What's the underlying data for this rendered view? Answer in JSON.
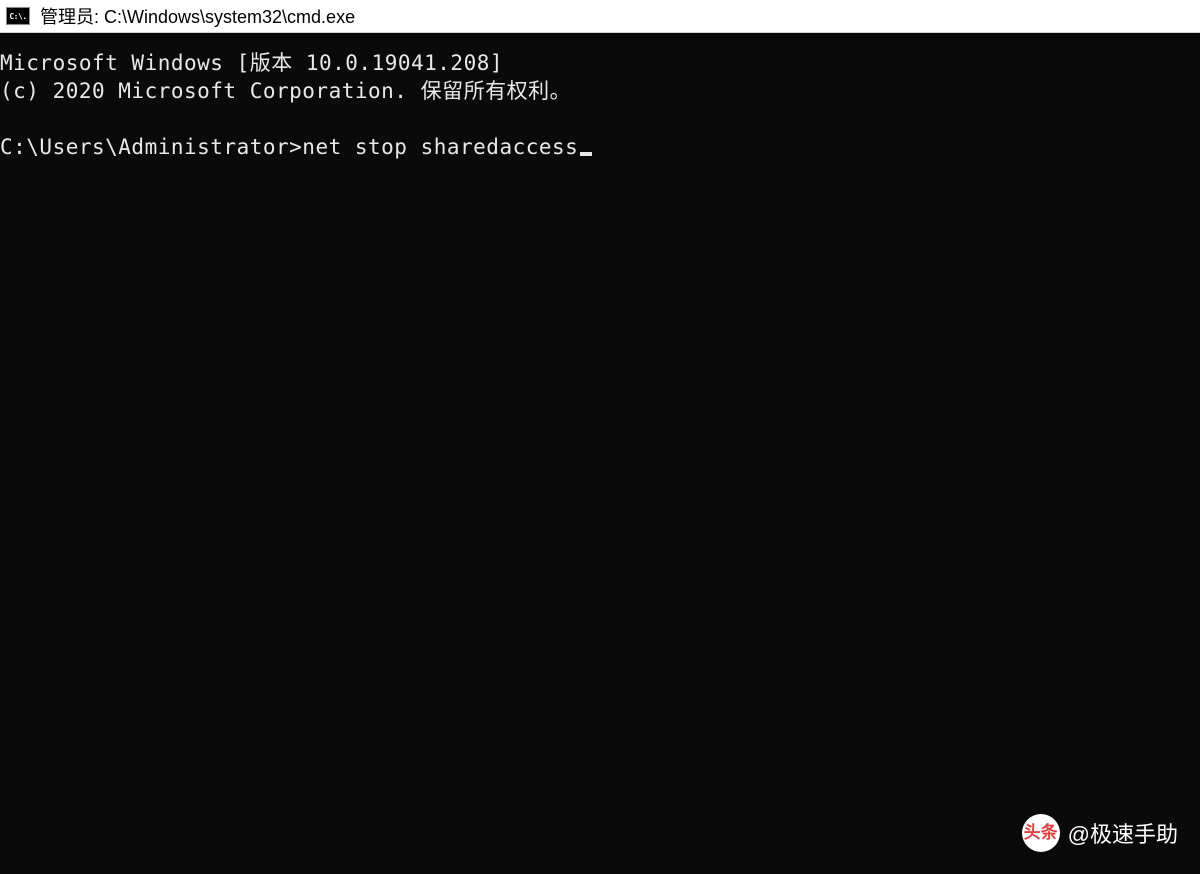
{
  "titlebar": {
    "icon_label": "C:\\.",
    "title": "管理员: C:\\Windows\\system32\\cmd.exe"
  },
  "terminal": {
    "line1": "Microsoft Windows [版本 10.0.19041.208]",
    "line2": "(c) 2020 Microsoft Corporation. 保留所有权利。",
    "prompt": "C:\\Users\\Administrator>",
    "command": "net stop sharedaccess"
  },
  "watermark": {
    "logo_text": "头条",
    "label": "@极速手助"
  }
}
